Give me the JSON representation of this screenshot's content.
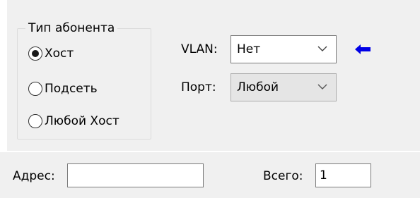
{
  "subscriber_type": {
    "title": "Тип абонента",
    "options": [
      {
        "label": "Хост",
        "checked": true
      },
      {
        "label": "Подсеть",
        "checked": false
      },
      {
        "label": "Любой Хост",
        "checked": false
      }
    ]
  },
  "vlan": {
    "label": "VLAN:",
    "value": "Нет"
  },
  "port": {
    "label": "Порт:",
    "value": "Любой"
  },
  "indicator": {
    "icon": "arrow-left-icon",
    "color": "#0000e6"
  },
  "address": {
    "label": "Адрес:",
    "value": ""
  },
  "total": {
    "label": "Всего:",
    "value": "1"
  }
}
